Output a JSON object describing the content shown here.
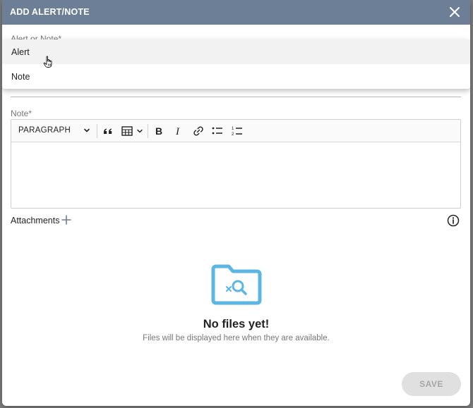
{
  "dialog": {
    "title": "ADD ALERT/NOTE"
  },
  "alert_or_note_field": {
    "label": "Alert or Note*",
    "options": [
      "Alert",
      "Note"
    ],
    "hovered_option": "Alert"
  },
  "note_field": {
    "label": "Note*",
    "toolbar": {
      "paragraph_style": "PARAGRAPH"
    }
  },
  "attachments": {
    "label": "Attachments"
  },
  "empty_state": {
    "title": "No files yet!",
    "subtitle": "Files will be displayed here when they are available."
  },
  "footer": {
    "save_label": "SAVE"
  },
  "colors": {
    "header": "#6d7e97",
    "folder": "#5bb6e4",
    "save_disabled_bg": "#e0e0e0"
  },
  "icons": [
    "close-icon",
    "chevron-down-icon",
    "blockquote-icon",
    "table-icon",
    "bold-icon",
    "italic-icon",
    "link-icon",
    "bulleted-list-icon",
    "numbered-list-icon",
    "plus-icon",
    "info-icon",
    "folder-search-icon",
    "hand-cursor-icon"
  ]
}
